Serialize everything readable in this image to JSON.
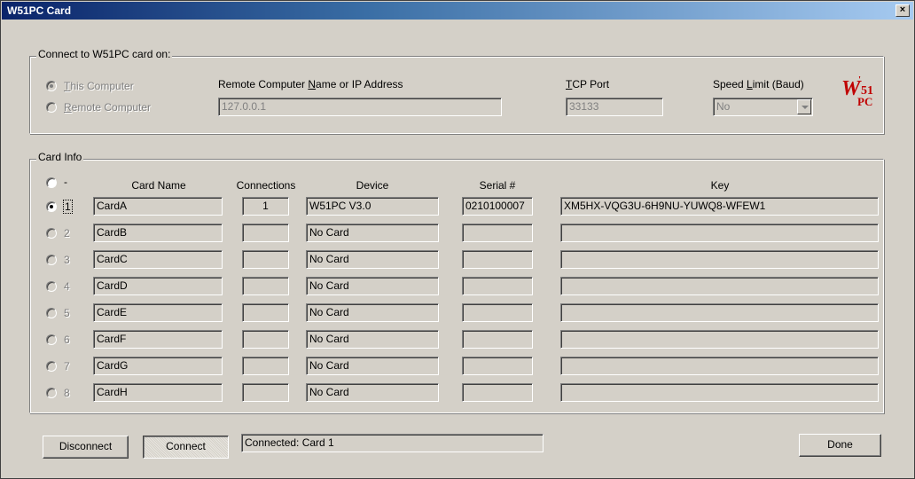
{
  "window": {
    "title": "W51PC Card",
    "close_glyph": "×"
  },
  "connect_group": {
    "label": "Connect to W51PC card on:",
    "this_computer": {
      "prefix": "",
      "accel": "T",
      "rest": "his Computer"
    },
    "remote_computer": {
      "prefix": "",
      "accel": "R",
      "rest": "emote Computer"
    },
    "remote_name_label": {
      "prefix": "Remote Computer ",
      "accel": "N",
      "rest": "ame or IP Address"
    },
    "remote_name_value": "127.0.0.1",
    "tcp_port_label": {
      "prefix": "",
      "accel": "T",
      "rest": "CP Port"
    },
    "tcp_port_value": "33133",
    "speed_label": {
      "prefix": "Speed ",
      "accel": "L",
      "rest": "imit (Baud)"
    },
    "speed_value": "No",
    "logo": {
      "w": "W",
      "n": "51",
      "pc": "PC",
      "tick": "'"
    }
  },
  "card_info": {
    "label": "Card Info",
    "none_radio_label": "-",
    "headers": {
      "card_name": "Card Name",
      "connections": "Connections",
      "device": "Device",
      "serial": "Serial #",
      "key": "Key"
    },
    "rows": [
      {
        "num": "1",
        "name": "CardA",
        "connections": "1",
        "device": "W51PC V3.0",
        "serial": "0210100007",
        "key": "XM5HX-VQG3U-6H9NU-YUWQ8-WFEW1",
        "selected": true
      },
      {
        "num": "2",
        "name": "CardB",
        "connections": "",
        "device": "No Card",
        "serial": "",
        "key": "",
        "selected": false
      },
      {
        "num": "3",
        "name": "CardC",
        "connections": "",
        "device": "No Card",
        "serial": "",
        "key": "",
        "selected": false
      },
      {
        "num": "4",
        "name": "CardD",
        "connections": "",
        "device": "No Card",
        "serial": "",
        "key": "",
        "selected": false
      },
      {
        "num": "5",
        "name": "CardE",
        "connections": "",
        "device": "No Card",
        "serial": "",
        "key": "",
        "selected": false
      },
      {
        "num": "6",
        "name": "CardF",
        "connections": "",
        "device": "No Card",
        "serial": "",
        "key": "",
        "selected": false
      },
      {
        "num": "7",
        "name": "CardG",
        "connections": "",
        "device": "No Card",
        "serial": "",
        "key": "",
        "selected": false
      },
      {
        "num": "8",
        "name": "CardH",
        "connections": "",
        "device": "No Card",
        "serial": "",
        "key": "",
        "selected": false
      }
    ]
  },
  "footer": {
    "disconnect": "Disconnect",
    "connect": "Connect",
    "status": "Connected: Card 1",
    "done": "Done"
  },
  "colors": {
    "face": "#d4d0c8",
    "title_start": "#0a246a",
    "title_end": "#a6caf0",
    "logo": "#c00000"
  }
}
